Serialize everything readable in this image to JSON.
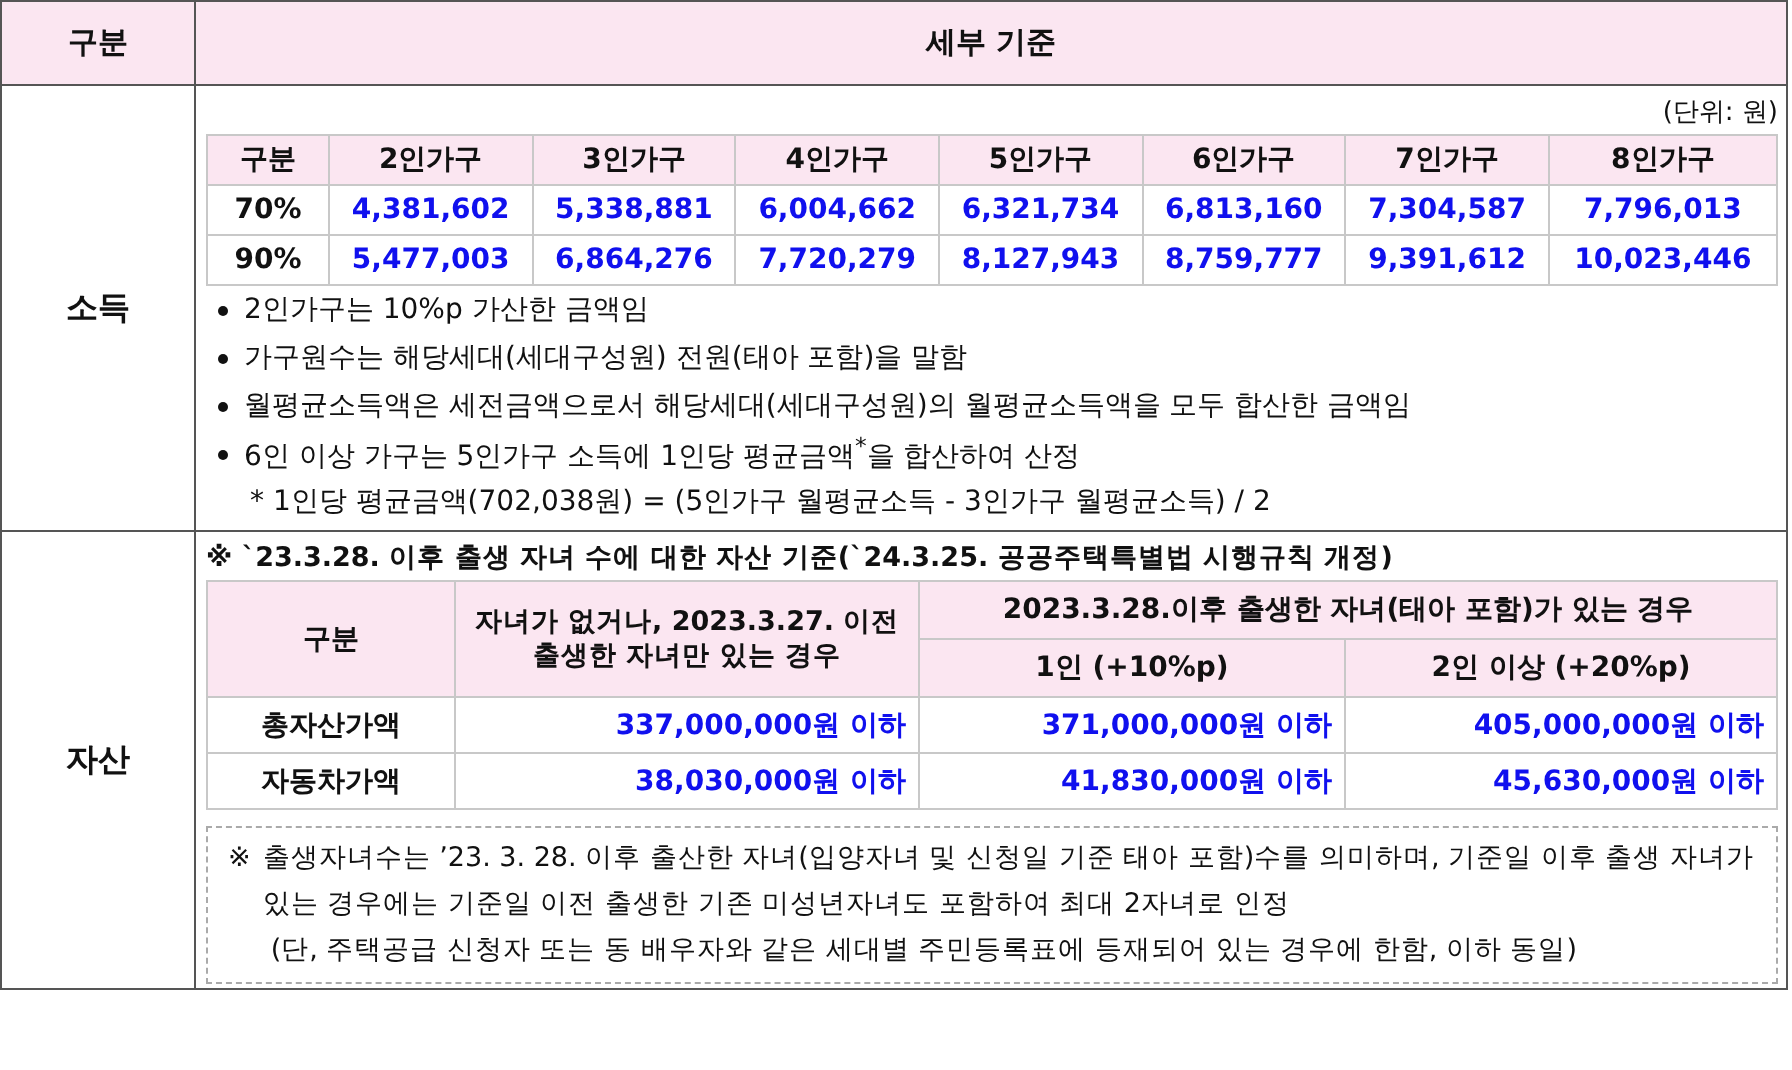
{
  "header": {
    "category": "구분",
    "detail": "세부 기준"
  },
  "income": {
    "label": "소득",
    "unit": "(단위: 원)",
    "columns": [
      "구분",
      "2인가구",
      "3인가구",
      "4인가구",
      "5인가구",
      "6인가구",
      "7인가구",
      "8인가구"
    ],
    "rows": [
      {
        "label": "70%",
        "values": [
          "4,381,602",
          "5,338,881",
          "6,004,662",
          "6,321,734",
          "6,813,160",
          "7,304,587",
          "7,796,013"
        ]
      },
      {
        "label": "90%",
        "values": [
          "5,477,003",
          "6,864,276",
          "7,720,279",
          "8,127,943",
          "8,759,777",
          "9,391,612",
          "10,023,446"
        ]
      }
    ],
    "bullets": [
      "2인가구는 10%p 가산한 금액임",
      "가구원수는 해당세대(세대구성원) 전원(태아 포함)을 말함",
      "월평균소득액은 세전금액으로서 해당세대(세대구성원)의 월평균소득액을 모두 합산한 금액임",
      "6인 이상 가구는 5인가구 소득에 1인당 평균금액$^{*}$을 합산하여 산정"
    ],
    "footnote": "* 1인당 평균금액(702,038원) = (5인가구 월평균소득 - 3인가구 월평균소득) / 2"
  },
  "assets": {
    "label": "자산",
    "title": "※ `23.3.28. 이후 출생 자녀 수에 대한 자산 기준(`24.3.25. 공공주택특별법 시행규칙 개정)",
    "corner": "구분",
    "no_child_header": "자녀가 없거나, 2023.3.27. 이전 출생한 자녀만 있는 경우",
    "child_group_header": "2023.3.28.이후 출생한 자녀(태아 포함)가 있는 경우",
    "sub_headers": [
      "1인 (+10%p)",
      "2인 이상 (+20%p)"
    ],
    "rows": [
      {
        "label": "총자산가액",
        "values": [
          "337,000,000원 이하",
          "371,000,000원 이하",
          "405,000,000원 이하"
        ]
      },
      {
        "label": "자동차가액",
        "values": [
          "38,030,000원 이하",
          "41,830,000원 이하",
          "45,630,000원 이하"
        ]
      }
    ],
    "note_mark": "※",
    "note": "출생자녀수는 ’23. 3. 28. 이후 출산한 자녀(입양자녀 및 신청일 기준 태아 포함)수를 의미하며, 기준일 이후 출생 자녀가 있는 경우에는 기준일 이전 출생한 기존 미성년자녀도 포함하여 최대 2자녀로 인정",
    "note_sub": "(단, 주택공급 신청자 또는 동 배우자와 같은 세대별 주민등록표에 등재되어 있는 경우에 한함, 이하 동일)"
  }
}
